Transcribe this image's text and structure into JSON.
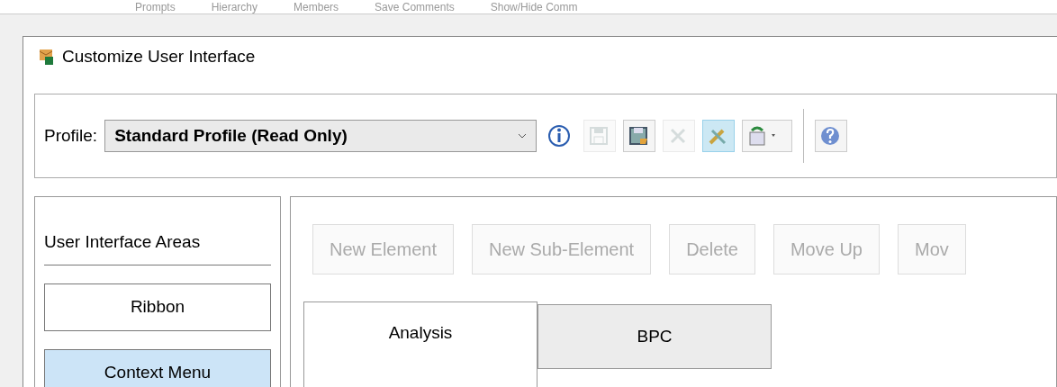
{
  "background_toolbar": [
    "Prompts",
    "Hierarchy",
    "Members",
    "Save Comments",
    "Show/Hide Comm"
  ],
  "window": {
    "title": "Customize User Interface"
  },
  "profile": {
    "label": "Profile:",
    "value": "Standard Profile (Read Only)"
  },
  "toolbar": [
    {
      "kind": "info",
      "disabled": false,
      "selected": false
    },
    {
      "kind": "save",
      "disabled": true,
      "selected": false
    },
    {
      "kind": "save-as",
      "disabled": false,
      "selected": false
    },
    {
      "kind": "delete",
      "disabled": true,
      "selected": false
    },
    {
      "kind": "tools",
      "disabled": false,
      "selected": true
    },
    {
      "kind": "import",
      "disabled": false,
      "selected": false
    },
    {
      "kind": "help",
      "disabled": false,
      "selected": false
    }
  ],
  "areas": {
    "title": "User Interface Areas",
    "items": [
      {
        "label": "Ribbon",
        "selected": false
      },
      {
        "label": "Context Menu",
        "selected": true
      }
    ]
  },
  "actions": [
    {
      "label": "New Element",
      "disabled": true
    },
    {
      "label": "New Sub-Element",
      "disabled": true
    },
    {
      "label": "Delete",
      "disabled": true
    },
    {
      "label": "Move Up",
      "disabled": true
    },
    {
      "label": "Mov",
      "disabled": true
    }
  ],
  "tabs": [
    {
      "label": "Analysis",
      "selected": true
    },
    {
      "label": "BPC",
      "selected": false
    }
  ]
}
